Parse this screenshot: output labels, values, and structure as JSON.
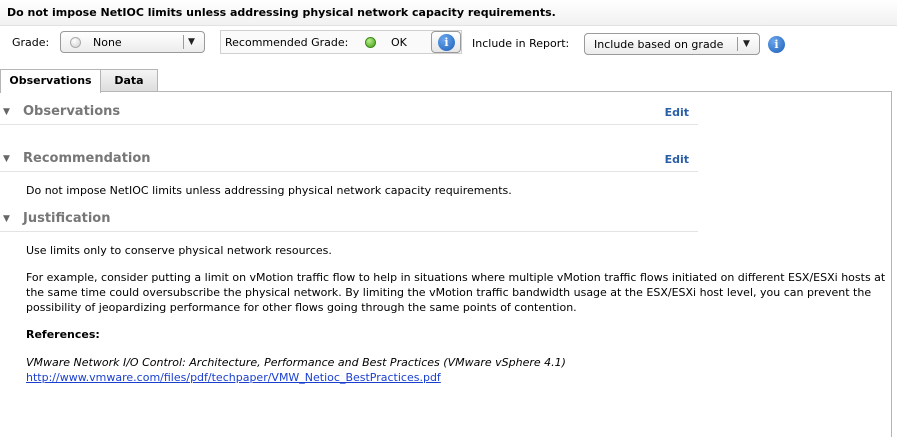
{
  "header": {
    "title": "Do not impose NetIOC limits unless addressing physical network capacity requirements."
  },
  "toolbar": {
    "grade_label": "Grade:",
    "grade_value": "None",
    "recommended_label": "Recommended Grade:",
    "recommended_value": "OK",
    "report_label": "Include in Report:",
    "report_value": "Include based on grade"
  },
  "tabs": [
    {
      "label": "Observations",
      "active": true
    },
    {
      "label": "Data",
      "active": false
    }
  ],
  "sections": {
    "observations": {
      "title": "Observations",
      "edit_label": "Edit"
    },
    "recommendation": {
      "title": "Recommendation",
      "edit_label": "Edit",
      "body": "Do not impose NetIOC limits unless addressing physical network capacity requirements."
    },
    "justification": {
      "title": "Justification",
      "para1": "Use limits only to conserve physical network resources.",
      "para2_lines": [
        "For example, consider putting a limit on vMotion traffic flow to help in situations where multiple vMotion traffic flows initiated on different ESX/ESXi hosts at",
        "the same time could oversubscribe the physical network. By limiting the vMotion traffic bandwidth usage at the ESX/ESXi host level, you can prevent the",
        "possibility of jeopardizing performance for other flows going through the same points of contention."
      ],
      "references_label": "References:",
      "reference_title": "VMware Network I/O Control: Architecture, Performance and Best Practices (VMware vSphere 4.1)",
      "reference_link": "http://www.vmware.com/files/pdf/techpaper/VMW_Netioc_BestPractices.pdf"
    }
  },
  "icons": {
    "info": "info-icon",
    "collapse": "triangle-down-icon",
    "dropdown": "chevron-down-icon"
  },
  "colors": {
    "ok_status": "#5cc02a",
    "none_status": "#e0e0e0",
    "link": "#2a5fa8"
  }
}
